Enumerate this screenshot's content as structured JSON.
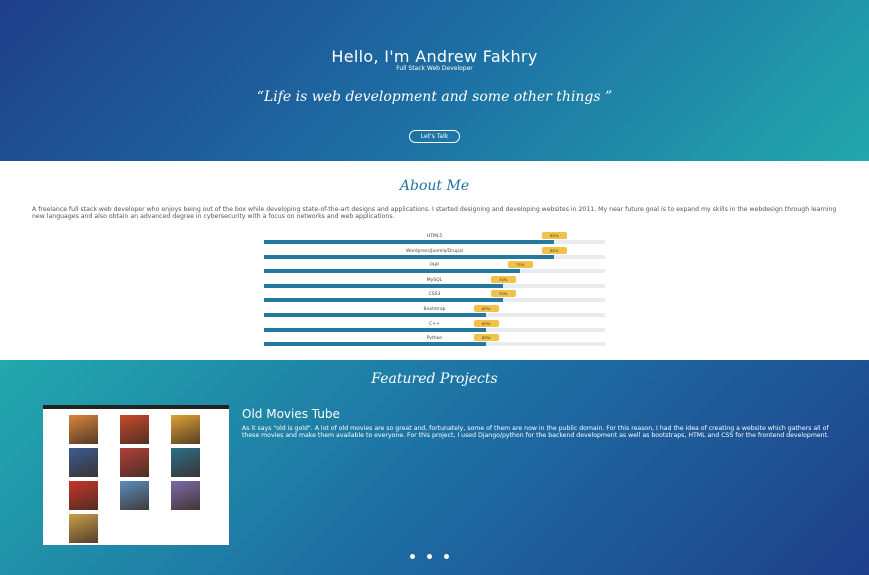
{
  "hero": {
    "title": "Hello, I'm Andrew Fakhry",
    "subtitle": "Full Stack Web Developer",
    "quote": "“Life is web development and some other things ”",
    "cta_label": "Let's Talk"
  },
  "about": {
    "heading": "About Me",
    "text": "A freelance full stack web developer who enjoys being out of the box while developing state-of-the-art designs and applications. I started designing and developing websites in 2011. My near future goal is to expand my skills in the webdesign through learning new languages and also obtain an advanced degree in cybersecurity with a focus on networks and web applications.",
    "skills": [
      {
        "label": "HTML5",
        "percent": 85,
        "badge": "85%"
      },
      {
        "label": "Wordpress/Joomla/Drupal",
        "percent": 85,
        "badge": "85%"
      },
      {
        "label": "PHP",
        "percent": 75,
        "badge": "75%"
      },
      {
        "label": "MySQL",
        "percent": 70,
        "badge": "70%"
      },
      {
        "label": "CSS3",
        "percent": 70,
        "badge": "70%"
      },
      {
        "label": "Bootstrap",
        "percent": 65,
        "badge": "65%"
      },
      {
        "label": "C++",
        "percent": 65,
        "badge": "65%"
      },
      {
        "label": "Python",
        "percent": 65,
        "badge": "65%"
      }
    ]
  },
  "projects": {
    "heading": "Featured Projects",
    "project_name": "Old Movies Tube",
    "project_desc": "As it says \"old is gold\". A lot of old movies are so great and, fortunately, some of them are now in the public domain. For this reason, I had the idea of creating a website which gathers all of these movies and make them available to everyone. For this project, I used Django/python for the backend development as well as bootstraps, HTML and CSS for the frontend development.",
    "poster_colors": [
      "#d9863c",
      "#c84a2b",
      "#e0a236",
      "#3a5d8f",
      "#b0413a",
      "#2c6e8a",
      "#c7352b",
      "#5a8ec0",
      "#7a6ca8",
      "#c9a04b"
    ],
    "carousel_active": 3
  }
}
